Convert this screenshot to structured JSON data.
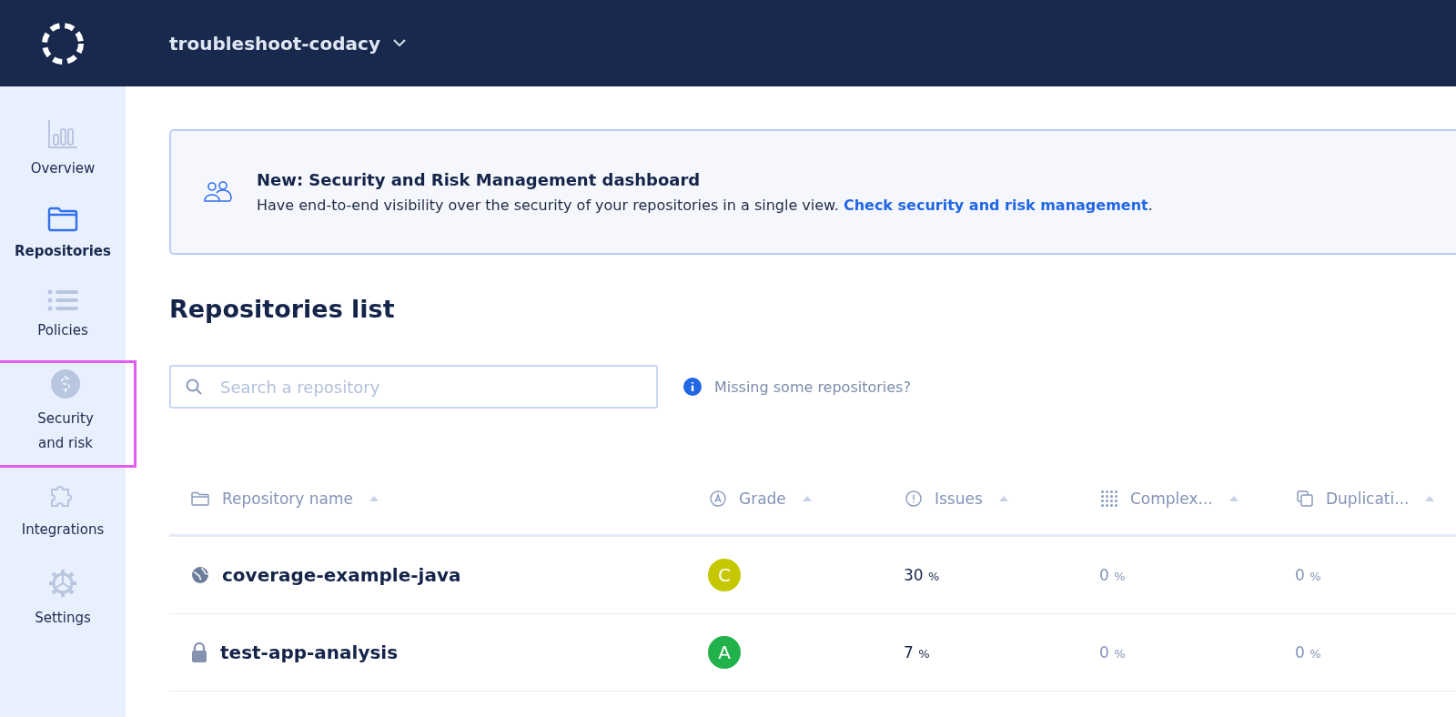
{
  "header": {
    "organization": "troubleshoot-codacy"
  },
  "sidebar": {
    "items": [
      {
        "label": "Overview",
        "kind": "chart",
        "selected": false,
        "highlighted": false
      },
      {
        "label": "Repositories",
        "kind": "folder",
        "selected": true,
        "highlighted": false
      },
      {
        "label": "Policies",
        "kind": "list",
        "selected": false,
        "highlighted": false
      },
      {
        "label": "Security and risk",
        "kind": "shield",
        "selected": false,
        "highlighted": true
      },
      {
        "label": "Integrations",
        "kind": "puzzle",
        "selected": false,
        "highlighted": false
      },
      {
        "label": "Settings",
        "kind": "gear",
        "selected": false,
        "highlighted": false
      }
    ]
  },
  "banner": {
    "title": "New: Security and Risk Management dashboard",
    "text": "Have end-to-end visibility over the security of your repositories in a single view.",
    "link": "Check security and risk management",
    "after_link": "."
  },
  "page_title": "Repositories list",
  "search": {
    "placeholder": "Search a repository"
  },
  "missing_link": "Missing some repositories?",
  "table": {
    "columns": [
      {
        "label": "Repository name",
        "kind": "folder"
      },
      {
        "label": "Grade",
        "kind": "grade"
      },
      {
        "label": "Issues",
        "kind": "alert"
      },
      {
        "label": "Complex...",
        "kind": "dots"
      },
      {
        "label": "Duplicati...",
        "kind": "copy"
      }
    ],
    "rows": [
      {
        "kind": "public",
        "name": "coverage-example-java",
        "grade": "C",
        "color": "#c5c800",
        "issues": {
          "value": "30",
          "unit": "%"
        },
        "complexity": {
          "value": "0",
          "unit": "%"
        },
        "duplication": {
          "value": "0",
          "unit": "%"
        }
      },
      {
        "kind": "private",
        "name": "test-app-analysis",
        "grade": "A",
        "color": "#22b24c",
        "issues": {
          "value": "7",
          "unit": "%"
        },
        "complexity": {
          "value": "0",
          "unit": "%"
        },
        "duplication": {
          "value": "0",
          "unit": "%"
        }
      }
    ]
  }
}
